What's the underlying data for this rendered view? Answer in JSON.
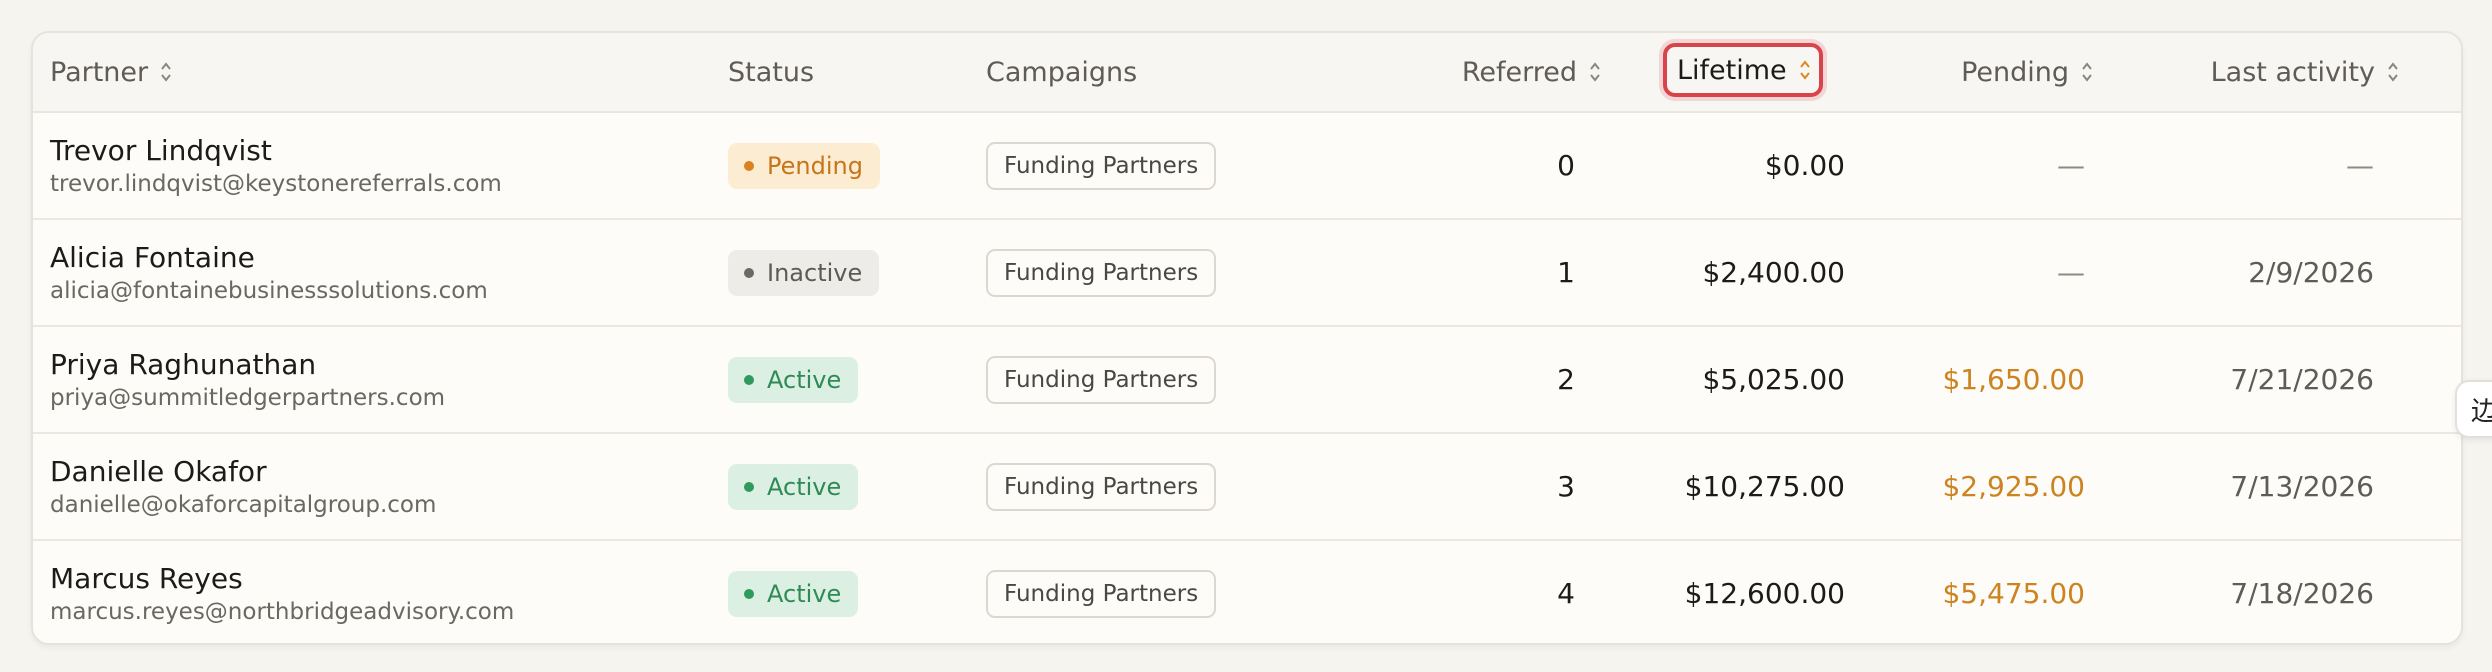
{
  "table": {
    "columns": [
      {
        "label": "Partner",
        "sortable": true
      },
      {
        "label": "Status",
        "sortable": false
      },
      {
        "label": "Campaigns",
        "sortable": false
      },
      {
        "label": "Referred",
        "sortable": true
      },
      {
        "label": "Lifetime",
        "sortable": true,
        "active": true
      },
      {
        "label": "Pending",
        "sortable": true
      },
      {
        "label": "Last activity",
        "sortable": true
      }
    ],
    "rows": [
      {
        "name": "Trevor Lindqvist",
        "email": "trevor.lindqvist@keystonereferrals.com",
        "status": "Pending",
        "campaign": "Funding Partners",
        "referred": "0",
        "lifetime": "$0.00",
        "pending": "—",
        "last_activity": "—"
      },
      {
        "name": "Alicia Fontaine",
        "email": "alicia@fontainebusinesssolutions.com",
        "status": "Inactive",
        "campaign": "Funding Partners",
        "referred": "1",
        "lifetime": "$2,400.00",
        "pending": "—",
        "last_activity": "2/9/2026"
      },
      {
        "name": "Priya Raghunathan",
        "email": "priya@summitledgerpartners.com",
        "status": "Active",
        "campaign": "Funding Partners",
        "referred": "2",
        "lifetime": "$5,025.00",
        "pending": "$1,650.00",
        "last_activity": "7/21/2026"
      },
      {
        "name": "Danielle Okafor",
        "email": "danielle@okaforcapitalgroup.com",
        "status": "Active",
        "campaign": "Funding Partners",
        "referred": "3",
        "lifetime": "$10,275.00",
        "pending": "$2,925.00",
        "last_activity": "7/13/2026"
      },
      {
        "name": "Marcus Reyes",
        "email": "marcus.reyes@northbridgeadvisory.com",
        "status": "Active",
        "campaign": "Funding Partners",
        "referred": "4",
        "lifetime": "$12,600.00",
        "pending": "$5,475.00",
        "last_activity": "7/18/2026"
      }
    ]
  },
  "side_tab": {
    "glyph": "边"
  },
  "colors": {
    "accent_highlight": "#d9444c",
    "pending": "#cd8420",
    "active": "#2f8a56",
    "inactive": "#5e5b55"
  }
}
